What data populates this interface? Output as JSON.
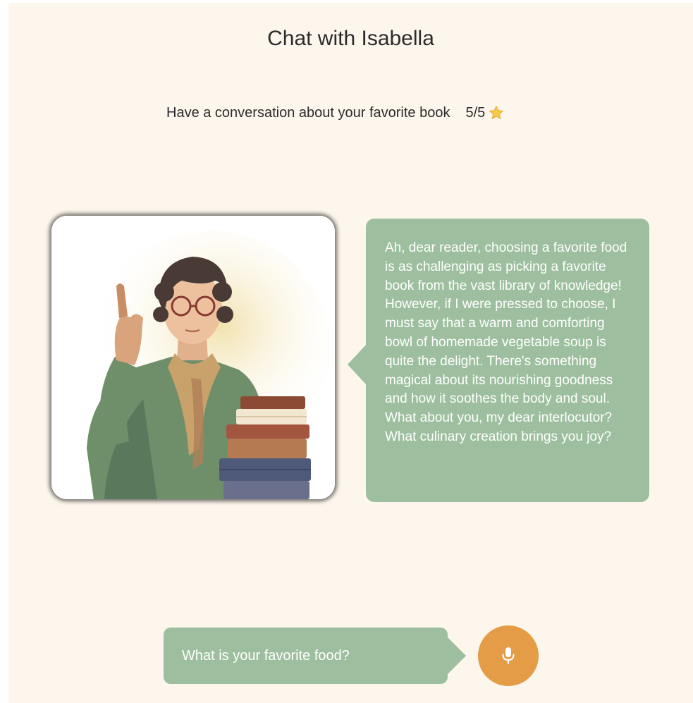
{
  "header": {
    "title": "Chat with Isabella"
  },
  "task": {
    "description": "Have a conversation about your favorite book",
    "score": "5/5",
    "score_icon": "star-icon"
  },
  "avatar": {
    "icon": "teacher-portrait"
  },
  "assistant_message": {
    "text": "Ah, dear reader, choosing a favorite food is as challenging as picking a favorite book from the vast library of knowledge! However, if I were pressed to choose, I must say that a warm and comforting bowl of homemade vegetable soup is quite the delight. There's something magical about its nourishing goodness and how it soothes the body and soul. What about you, my dear interlocutor? What culinary creation brings you joy?"
  },
  "user_message": {
    "text": "What is your favorite food?"
  },
  "mic_button": {
    "icon": "microphone-icon"
  },
  "colors": {
    "background": "#fdf6ec",
    "bubble": "#9dbf9f",
    "mic": "#e59c47",
    "text_dark": "#2b2b2b",
    "text_light": "#ffffff"
  }
}
